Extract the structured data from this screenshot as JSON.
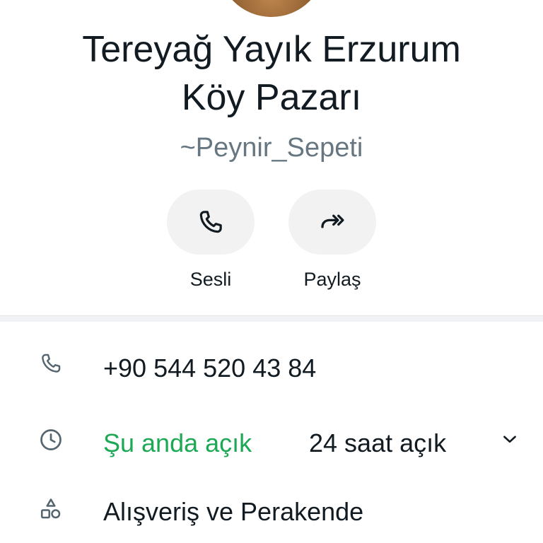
{
  "profile": {
    "name_line1": "Tereyağ Yayık Erzurum",
    "name_line2": "Köy Pazarı",
    "subname": "~Peynir_Sepeti"
  },
  "actions": {
    "call_label": "Sesli",
    "share_label": "Paylaş"
  },
  "details": {
    "phone": "+90 544 520 43 84",
    "open_status": "Şu anda açık",
    "hours": "24 saat açık",
    "category": "Alışveriş ve Perakende"
  },
  "colors": {
    "open_status": "#1da856",
    "subtext": "#667781",
    "button_bg": "#f2f2f2"
  },
  "icons": {
    "call": "phone-icon",
    "share": "share-forward-icon",
    "phone_row": "phone-icon",
    "hours_row": "clock-icon",
    "category_row": "shapes-icon",
    "expand": "chevron-down-icon"
  }
}
